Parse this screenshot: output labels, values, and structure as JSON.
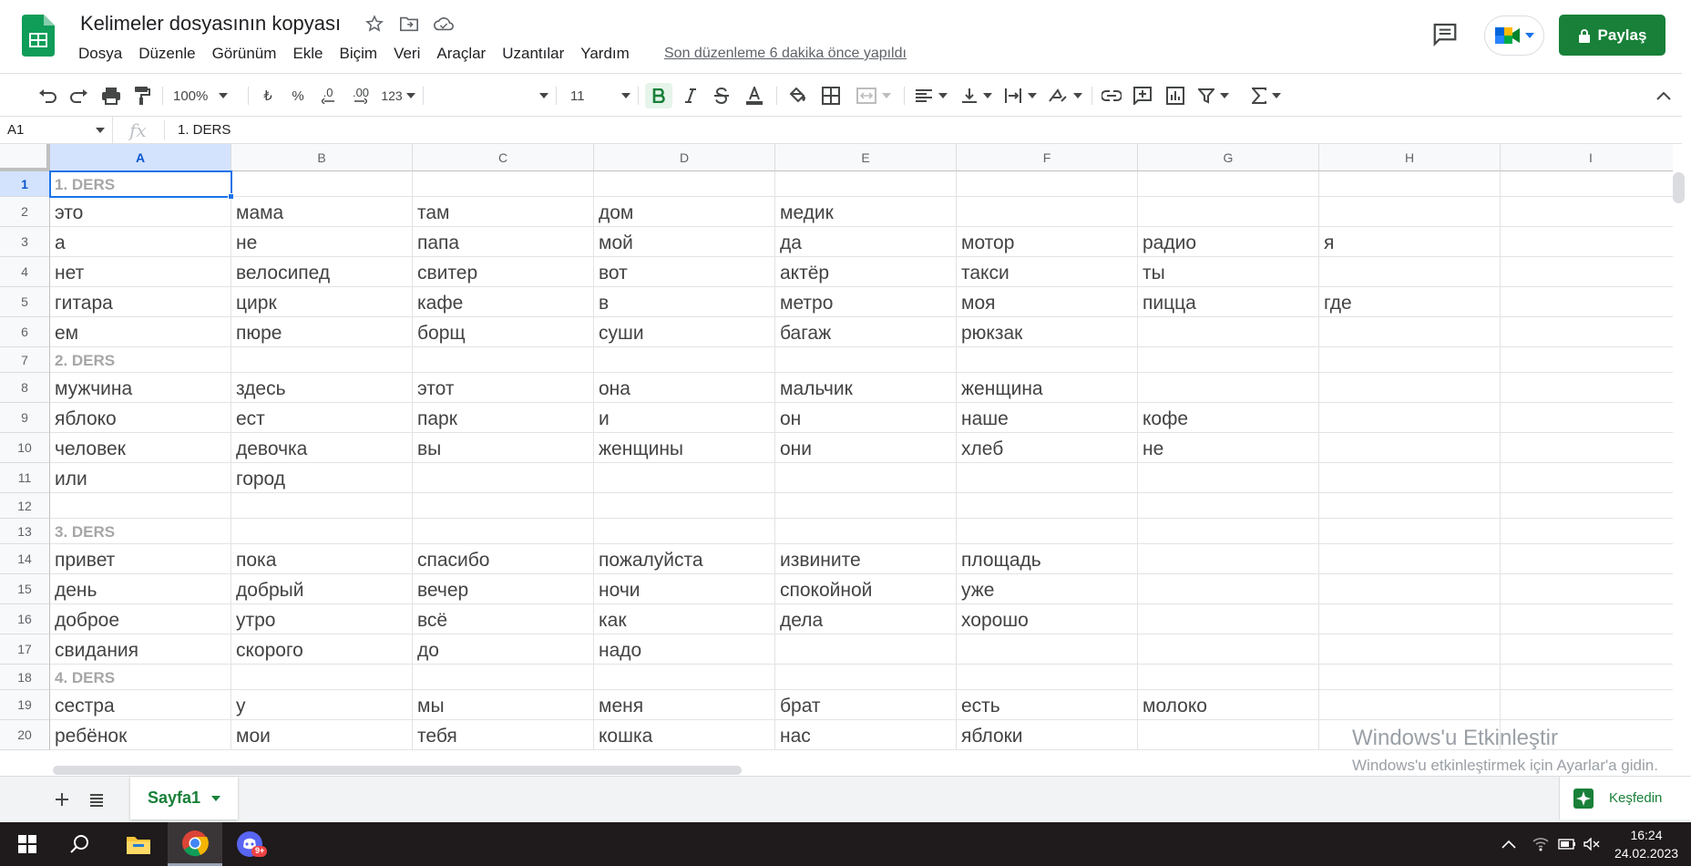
{
  "header": {
    "doc_title": "Kelimeler dosyasının kopyası",
    "menu": [
      "Dosya",
      "Düzenle",
      "Görünüm",
      "Ekle",
      "Biçim",
      "Veri",
      "Araçlar",
      "Uzantılar",
      "Yardım"
    ],
    "last_edit": "Son düzenleme 6 dakika önce yapıldı",
    "share_label": "Paylaş",
    "brand_color": "#188038"
  },
  "toolbar": {
    "zoom": "100%",
    "currency": "₺",
    "percent": "%",
    "dec_decrease": ".0",
    "dec_increase": ".00",
    "more_formats": "123",
    "font_family": "",
    "font_size": "11"
  },
  "formula_bar": {
    "name_box": "A1",
    "fx": "fx",
    "content": "1. DERS"
  },
  "grid": {
    "columns": [
      "A",
      "B",
      "C",
      "D",
      "E",
      "F",
      "G",
      "H",
      "I"
    ],
    "rows": [
      {
        "n": "1",
        "head": true,
        "cells": [
          "1. DERS",
          "",
          "",
          "",
          "",
          "",
          "",
          "",
          ""
        ]
      },
      {
        "n": "2",
        "cells": [
          "это",
          "мама",
          "там",
          "дом",
          "медик",
          "",
          "",
          "",
          ""
        ]
      },
      {
        "n": "3",
        "cells": [
          "а",
          "не",
          "папа",
          "мой",
          "да",
          "мотор",
          "радио",
          "я",
          ""
        ]
      },
      {
        "n": "4",
        "cells": [
          "нет",
          "велосипед",
          "свитер",
          "вот",
          "актёр",
          "такси",
          "ты",
          "",
          ""
        ]
      },
      {
        "n": "5",
        "cells": [
          "гитара",
          "цирк",
          "кафе",
          "в",
          "метро",
          "моя",
          "пицца",
          "где",
          ""
        ]
      },
      {
        "n": "6",
        "cells": [
          "ем",
          "пюре",
          "борщ",
          "суши",
          "багаж",
          "рюкзак",
          "",
          "",
          ""
        ]
      },
      {
        "n": "7",
        "head": true,
        "cells": [
          "2. DERS",
          "",
          "",
          "",
          "",
          "",
          "",
          "",
          ""
        ]
      },
      {
        "n": "8",
        "cells": [
          "мужчина",
          "здесь",
          "этот",
          "она",
          "мальчик",
          "женщина",
          "",
          "",
          ""
        ]
      },
      {
        "n": "9",
        "cells": [
          "яблоко",
          "ест",
          "парк",
          "и",
          "он",
          "наше",
          "кофе",
          "",
          ""
        ]
      },
      {
        "n": "10",
        "cells": [
          "человек",
          "девочка",
          "вы",
          "женщины",
          "они",
          "хлеб",
          "не",
          "",
          ""
        ]
      },
      {
        "n": "11",
        "cells": [
          "или",
          "город",
          "",
          "",
          "",
          "",
          "",
          "",
          ""
        ]
      },
      {
        "n": "12",
        "cells": [
          "",
          "",
          "",
          "",
          "",
          "",
          "",
          "",
          ""
        ]
      },
      {
        "n": "13",
        "head": true,
        "cells": [
          "3. DERS",
          "",
          "",
          "",
          "",
          "",
          "",
          "",
          ""
        ]
      },
      {
        "n": "14",
        "cells": [
          "привет",
          "пока",
          "спасибо",
          "пожалуйста",
          "извините",
          "площадь",
          "",
          "",
          ""
        ]
      },
      {
        "n": "15",
        "cells": [
          "день",
          "добрый",
          "вечер",
          "ночи",
          "спокойной",
          "уже",
          "",
          "",
          ""
        ]
      },
      {
        "n": "16",
        "cells": [
          "доброе",
          "утро",
          "всё",
          "как",
          "дела",
          "хорошо",
          "",
          "",
          ""
        ]
      },
      {
        "n": "17",
        "cells": [
          "свидания",
          "скорого",
          "до",
          "надо",
          "",
          "",
          "",
          "",
          ""
        ]
      },
      {
        "n": "18",
        "head": true,
        "cells": [
          "4. DERS",
          "",
          "",
          "",
          "",
          "",
          "",
          "",
          ""
        ]
      },
      {
        "n": "19",
        "cells": [
          "сестра",
          "у",
          "мы",
          "меня",
          "брат",
          "есть",
          "молоко",
          "",
          ""
        ]
      },
      {
        "n": "20",
        "cells": [
          "ребёнок",
          "мои",
          "тебя",
          "кошка",
          "нас",
          "яблоки",
          "",
          "",
          ""
        ]
      }
    ]
  },
  "watermark": {
    "line1": "Windows'u Etkinleştir",
    "line2": "Windows'u etkinleştirmek için Ayarlar'a gidin."
  },
  "sheets": {
    "active": "Sayfa1",
    "explore_label": "Keşfedin"
  },
  "taskbar": {
    "time": "16:24",
    "date": "24.02.2023",
    "discord_badge": "9+"
  }
}
